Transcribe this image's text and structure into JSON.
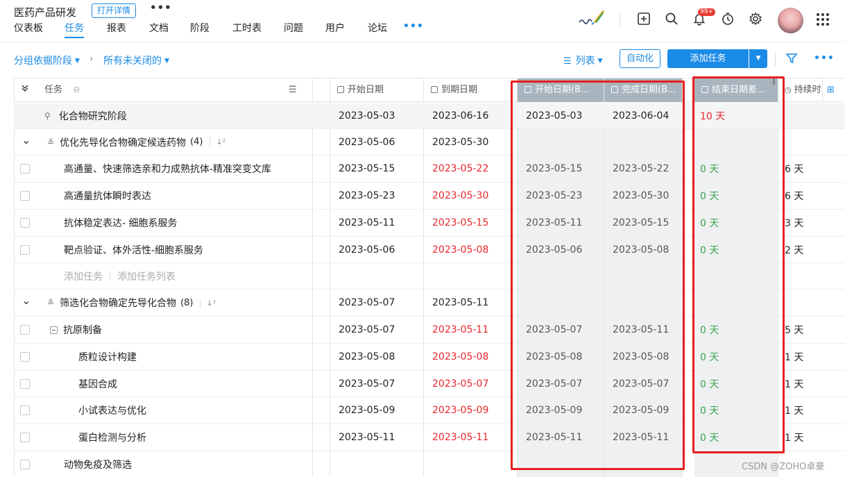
{
  "project": {
    "title": "医药产品研发",
    "open_detail": "打开详情",
    "more": "•••"
  },
  "nav": {
    "items": [
      "仪表板",
      "任务",
      "报表",
      "文档",
      "阶段",
      "工时表",
      "问题",
      "用户",
      "论坛"
    ],
    "active": "任务",
    "more": "•••"
  },
  "header_icons": [
    "add-icon",
    "search-icon",
    "bell-icon",
    "timer-icon",
    "gear-icon",
    "apps-grid-icon"
  ],
  "notification_badge": "99+",
  "toolbar": {
    "group_by": "分组依据阶段",
    "filter": "所有未关闭的",
    "view": "列表",
    "automation": "自动化",
    "add_task": "添加任务"
  },
  "columns": {
    "task": "任务",
    "start": "开始日期",
    "due": "到期日期",
    "baseline_start": "开始日期(B...",
    "baseline_finish": "完成日期(B...",
    "end_variance": "结束日期差...",
    "duration": "持续时"
  },
  "rows": [
    {
      "kind": "stage",
      "name": "化合物研究阶段",
      "start": "2023-05-03",
      "due": "2023-06-16",
      "b_start": "2023-05-03",
      "b_finish": "2023-06-04",
      "variance": "10 天",
      "variance_color": "red",
      "duration": ""
    },
    {
      "kind": "list",
      "name": "优化先导化合物确定候选药物",
      "count": "(4)",
      "start": "2023-05-06",
      "due": "2023-05-30",
      "b_start": "",
      "b_finish": "",
      "variance": "",
      "duration": ""
    },
    {
      "kind": "task",
      "name": "高通量、快速筛选亲和力成熟抗体-精准突变文库",
      "start": "2023-05-15",
      "due": "2023-05-22",
      "due_red": true,
      "b_start": "2023-05-15",
      "b_finish": "2023-05-22",
      "variance": "0 天",
      "variance_color": "green",
      "duration": "6 天"
    },
    {
      "kind": "task",
      "name": "高通量抗体瞬时表达",
      "start": "2023-05-23",
      "due": "2023-05-30",
      "due_red": true,
      "b_start": "2023-05-23",
      "b_finish": "2023-05-30",
      "variance": "0 天",
      "variance_color": "green",
      "duration": "6 天"
    },
    {
      "kind": "task",
      "name": "抗体稳定表达- 细胞系服务",
      "start": "2023-05-11",
      "due": "2023-05-15",
      "due_red": true,
      "b_start": "2023-05-11",
      "b_finish": "2023-05-15",
      "variance": "0 天",
      "variance_color": "green",
      "duration": "3 天"
    },
    {
      "kind": "task",
      "name": "靶点验证、体外活性-细胞系服务",
      "start": "2023-05-06",
      "due": "2023-05-08",
      "due_red": true,
      "b_start": "2023-05-06",
      "b_finish": "2023-05-08",
      "variance": "0 天",
      "variance_color": "green",
      "duration": "2 天"
    },
    {
      "kind": "add",
      "add_task": "添加任务",
      "add_list": "添加任务列表"
    },
    {
      "kind": "list",
      "name": "筛选化合物确定先导化合物",
      "count": "(8)",
      "start": "2023-05-07",
      "due": "2023-05-11",
      "b_start": "",
      "b_finish": "",
      "variance": "",
      "duration": ""
    },
    {
      "kind": "parent",
      "name": "抗原制备",
      "start": "2023-05-07",
      "due": "2023-05-11",
      "due_red": true,
      "b_start": "2023-05-07",
      "b_finish": "2023-05-11",
      "variance": "0 天",
      "variance_color": "green",
      "duration": "5 天"
    },
    {
      "kind": "sub",
      "name": "质粒设计构建",
      "start": "2023-05-08",
      "due": "2023-05-08",
      "due_red": true,
      "b_start": "2023-05-08",
      "b_finish": "2023-05-08",
      "variance": "0 天",
      "variance_color": "green",
      "duration": "1 天"
    },
    {
      "kind": "sub",
      "name": "基因合成",
      "start": "2023-05-07",
      "due": "2023-05-07",
      "due_red": true,
      "b_start": "2023-05-07",
      "b_finish": "2023-05-07",
      "variance": "0 天",
      "variance_color": "green",
      "duration": "1 天"
    },
    {
      "kind": "sub",
      "name": "小试表达与优化",
      "start": "2023-05-09",
      "due": "2023-05-09",
      "due_red": true,
      "b_start": "2023-05-09",
      "b_finish": "2023-05-09",
      "variance": "0 天",
      "variance_color": "green",
      "duration": "1 天"
    },
    {
      "kind": "sub",
      "name": "蛋白检测与分析",
      "start": "2023-05-11",
      "due": "2023-05-11",
      "due_red": true,
      "b_start": "2023-05-11",
      "b_finish": "2023-05-11",
      "variance": "0 天",
      "variance_color": "green",
      "duration": "1 天"
    },
    {
      "kind": "task",
      "name": "动物免疫及筛选",
      "start": "",
      "due": "",
      "b_start": "",
      "b_finish": "",
      "variance": "",
      "duration": ""
    }
  ],
  "watermark": "CSDN @ZOHO卓豪",
  "colors": {
    "accent": "#1a8be6",
    "overdue": "#e8262c",
    "on_track": "#3aa34a",
    "highlight": "#e81e1e"
  }
}
